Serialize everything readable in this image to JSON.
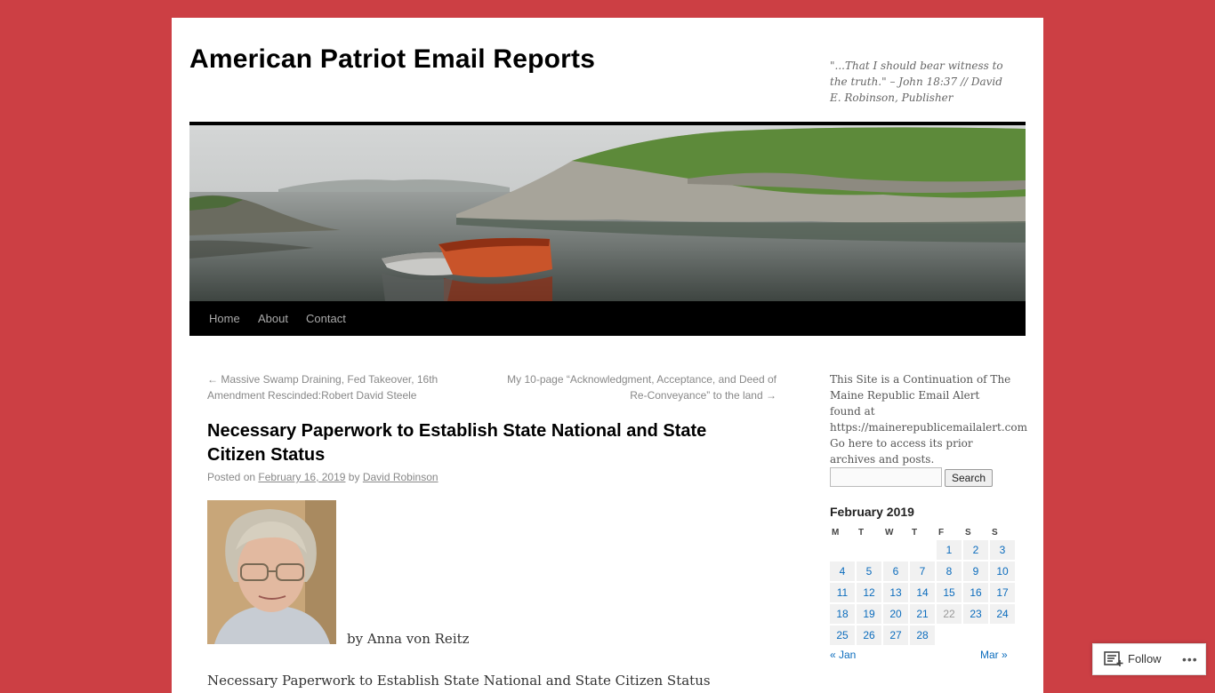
{
  "header": {
    "site_title": "American Patriot Email Reports",
    "site_description": "\"...That I should bear witness to the truth.\" – John 18:37 // David E. Robinson, Publisher"
  },
  "nav": {
    "items": [
      {
        "label": "Home"
      },
      {
        "label": "About"
      },
      {
        "label": "Contact"
      }
    ]
  },
  "post_navigation": {
    "previous": "← Massive Swamp Draining, Fed Takeover, 16th Amendment Rescinded:Robert David Steele",
    "next": "My 10-page “Acknowledgment, Acceptance, and Deed of Re-Conveyance” to the land →"
  },
  "post": {
    "title": "Necessary Paperwork to Establish State National and State Citizen Status",
    "posted_on_label": "Posted on",
    "date": "February 16, 2019",
    "by_label": "by",
    "author": "David Robinson",
    "byline": "by Anna von Reitz",
    "first_paragraph": "Necessary Paperwork to Establish State National and State Citizen Status"
  },
  "sidebar": {
    "intro_text": "This Site is a Continuation of The Maine Republic Email Alert found at https://mainerepublicemailalert.com Go here to access its prior archives and posts.",
    "search_placeholder": "",
    "search_button": "Search",
    "calendar": {
      "caption": "February 2019",
      "weekdays": [
        "M",
        "T",
        "W",
        "T",
        "F",
        "S",
        "S"
      ],
      "weeks": [
        [
          "",
          "",
          "",
          "",
          "1",
          "2",
          "3"
        ],
        [
          "4",
          "5",
          "6",
          "7",
          "8",
          "9",
          "10"
        ],
        [
          "11",
          "12",
          "13",
          "14",
          "15",
          "16",
          "17"
        ],
        [
          "18",
          "19",
          "20",
          "21",
          "22",
          "23",
          "24"
        ],
        [
          "25",
          "26",
          "27",
          "28",
          "",
          "",
          ""
        ]
      ],
      "prev": "« Jan",
      "next": "Mar »"
    }
  },
  "follow": {
    "label": "Follow",
    "more": "•••"
  },
  "colors": {
    "background": "#cc3f44",
    "link": "#0b6cbd",
    "nav_bar": "#000000"
  }
}
